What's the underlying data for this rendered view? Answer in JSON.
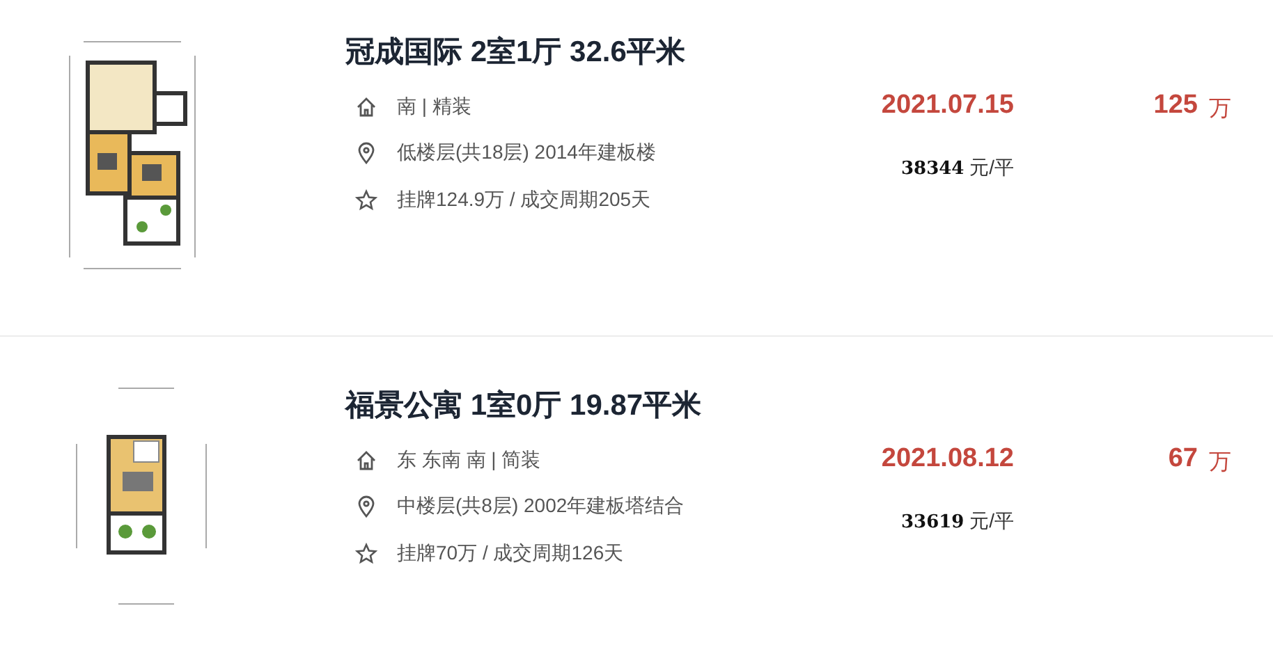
{
  "listings": [
    {
      "title": "冠成国际 2室1厅 32.6平米",
      "features": [
        {
          "kind": "house",
          "text": "南 | 精装"
        },
        {
          "kind": "location",
          "text": "低楼层(共18层) 2014年建板楼"
        },
        {
          "kind": "star",
          "text": "挂牌124.9万 / 成交周期205天"
        }
      ],
      "deal_date": "2021.07.15",
      "unit_price": "38344",
      "unit_price_suffix": "元/平",
      "total_price": "125",
      "total_price_unit": "万"
    },
    {
      "title": "福景公寓 1室0厅 19.87平米",
      "features": [
        {
          "kind": "house",
          "text": "东 东南 南 | 简装"
        },
        {
          "kind": "location",
          "text": "中楼层(共8层) 2002年建板塔结合"
        },
        {
          "kind": "star",
          "text": "挂牌70万 / 成交周期126天"
        }
      ],
      "deal_date": "2021.08.12",
      "unit_price": "33619",
      "unit_price_suffix": "元/平",
      "total_price": "67",
      "total_price_unit": "万"
    }
  ]
}
